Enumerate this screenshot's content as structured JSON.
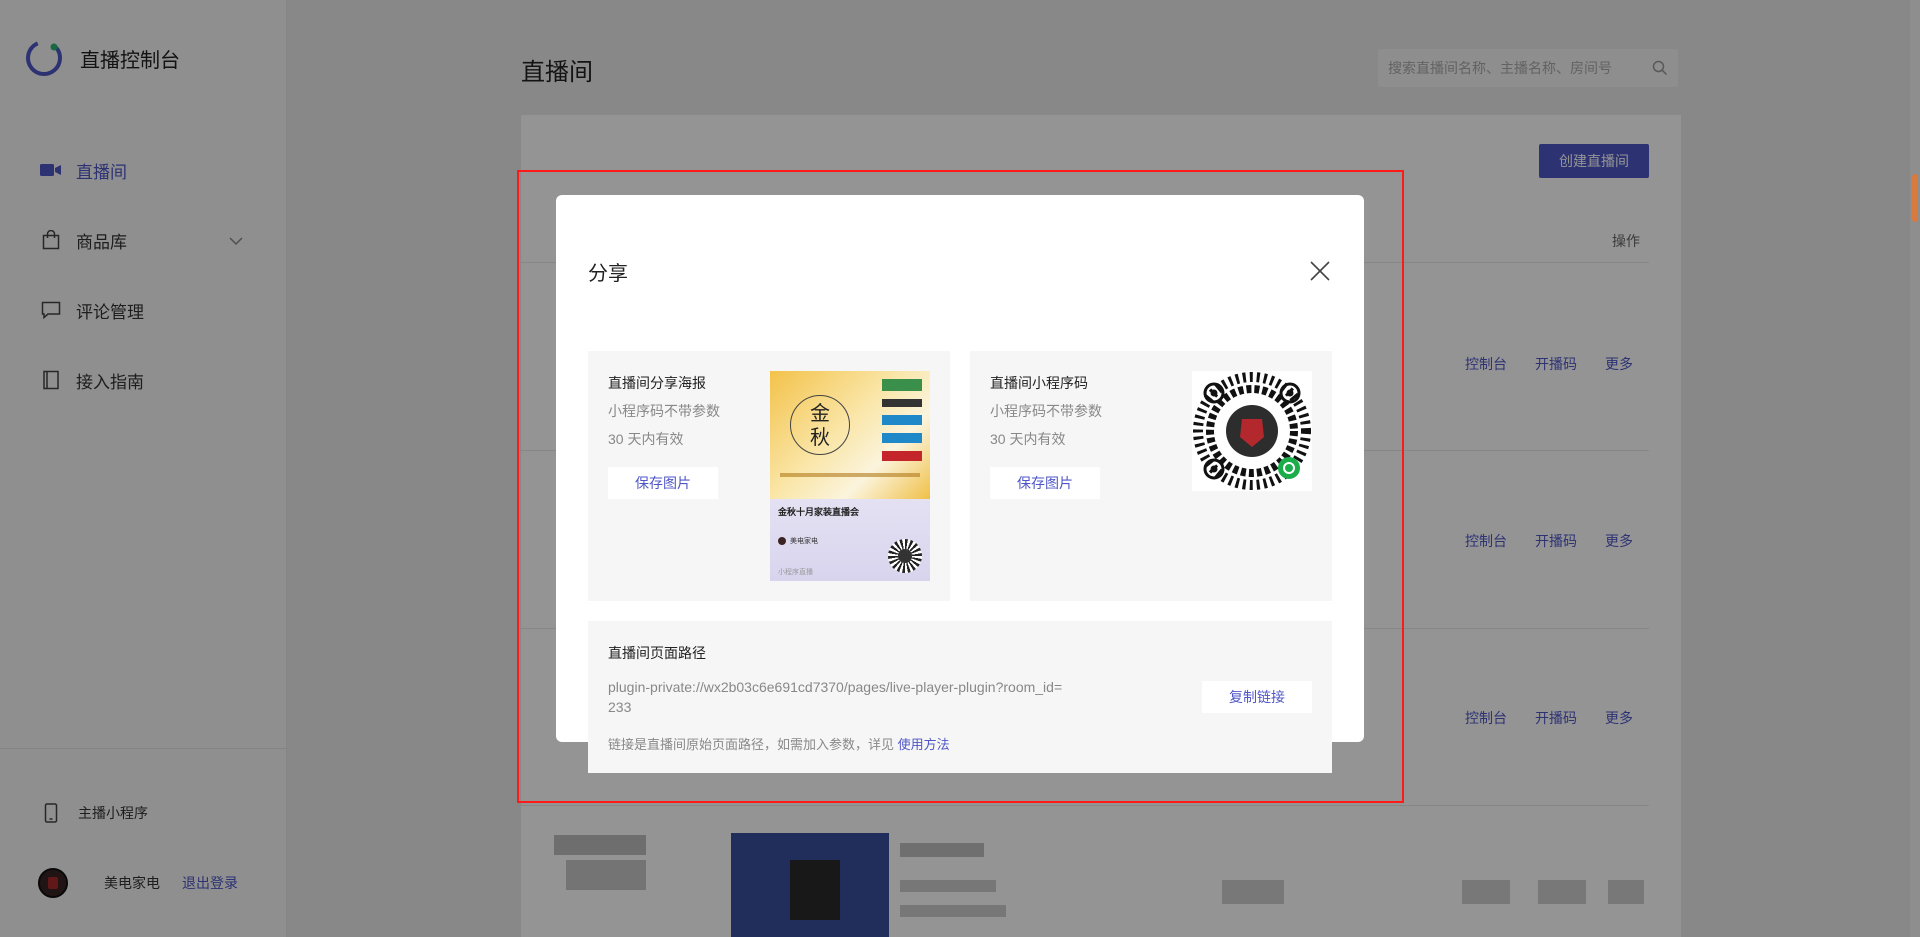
{
  "brand": {
    "title": "直播控制台"
  },
  "sidebar": {
    "items": [
      {
        "label": "直播间",
        "icon": "video-camera-icon",
        "active": true
      },
      {
        "label": "商品库",
        "icon": "shopping-bag-icon",
        "active": false
      },
      {
        "label": "评论管理",
        "icon": "comment-icon",
        "active": false
      },
      {
        "label": "接入指南",
        "icon": "book-icon",
        "active": false
      }
    ],
    "mini_program_label": "主播小程序",
    "user_name": "美电家电",
    "logout_label": "退出登录"
  },
  "main": {
    "title": "直播间",
    "search_placeholder": "搜索直播间名称、主播名称、房间号",
    "create_button": "创建直播间",
    "op_column": "操作",
    "row_actions": [
      "控制台",
      "开播码",
      "更多"
    ]
  },
  "modal": {
    "title": "分享",
    "poster_card": {
      "title": "直播间分享海报",
      "line1": "小程序码不带参数",
      "line2": "30 天内有效",
      "save_label": "保存图片",
      "poster_heading": "金秋十月家装直播会",
      "poster_big_chars": "金秋",
      "poster_user": "美电家电",
      "poster_footer": "小程序直播"
    },
    "qrcode_card": {
      "title": "直播间小程序码",
      "line1": "小程序码不带参数",
      "line2": "30 天内有效",
      "save_label": "保存图片"
    },
    "path_card": {
      "title": "直播间页面路径",
      "path": "plugin-private://wx2b03c6e691cd7370/pages/live-player-plugin?room_id=233",
      "copy_label": "复制链接",
      "hint": "链接是直播间原始页面路径，如需加入参数，详见",
      "hint_link": "使用方法"
    }
  },
  "colors": {
    "accent": "#4f56c7",
    "highlight_frame": "#ff1a1a"
  }
}
